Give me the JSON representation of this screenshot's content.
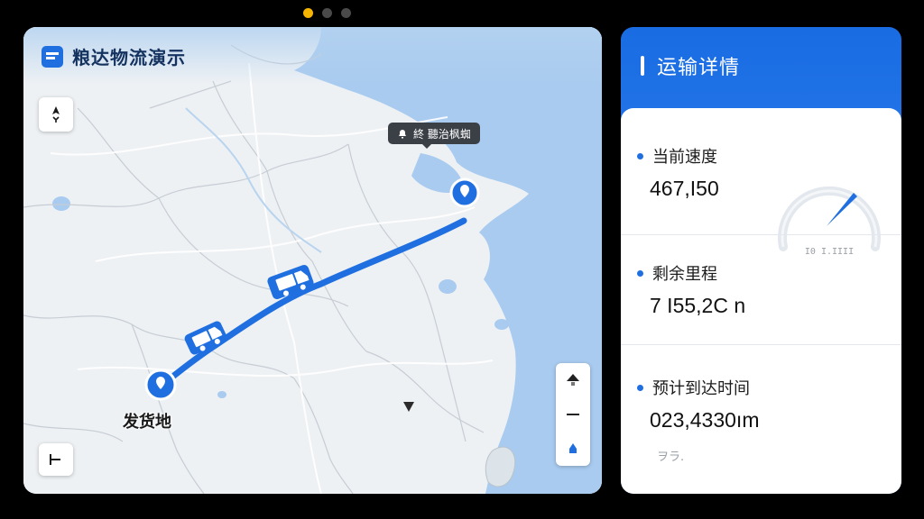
{
  "pager": {
    "count": 3,
    "active_index": 0
  },
  "map": {
    "app_title": "粮达物流演示",
    "destination_tooltip": "終 聽治枫蜘",
    "origin_label": "发货地",
    "colors": {
      "route": "#1f6fe0",
      "land": "#eef1f4",
      "sea": "#a9cbef",
      "pin": "#1f6fe0"
    }
  },
  "details": {
    "title": "运输详情",
    "metrics": [
      {
        "label": "当前速度",
        "value": "467,I50"
      },
      {
        "label": "剩余里程",
        "value": "7 I55,2C n"
      },
      {
        "label": "预计到达时间",
        "value": "023,4330ım"
      }
    ],
    "gauge_caption": "I0 I.IIII",
    "foot_note": "ヲラ.",
    "colors": {
      "accent": "#1f6fe0",
      "header_gradient": [
        "#1a6ce3",
        "#3b8cf2"
      ]
    }
  }
}
